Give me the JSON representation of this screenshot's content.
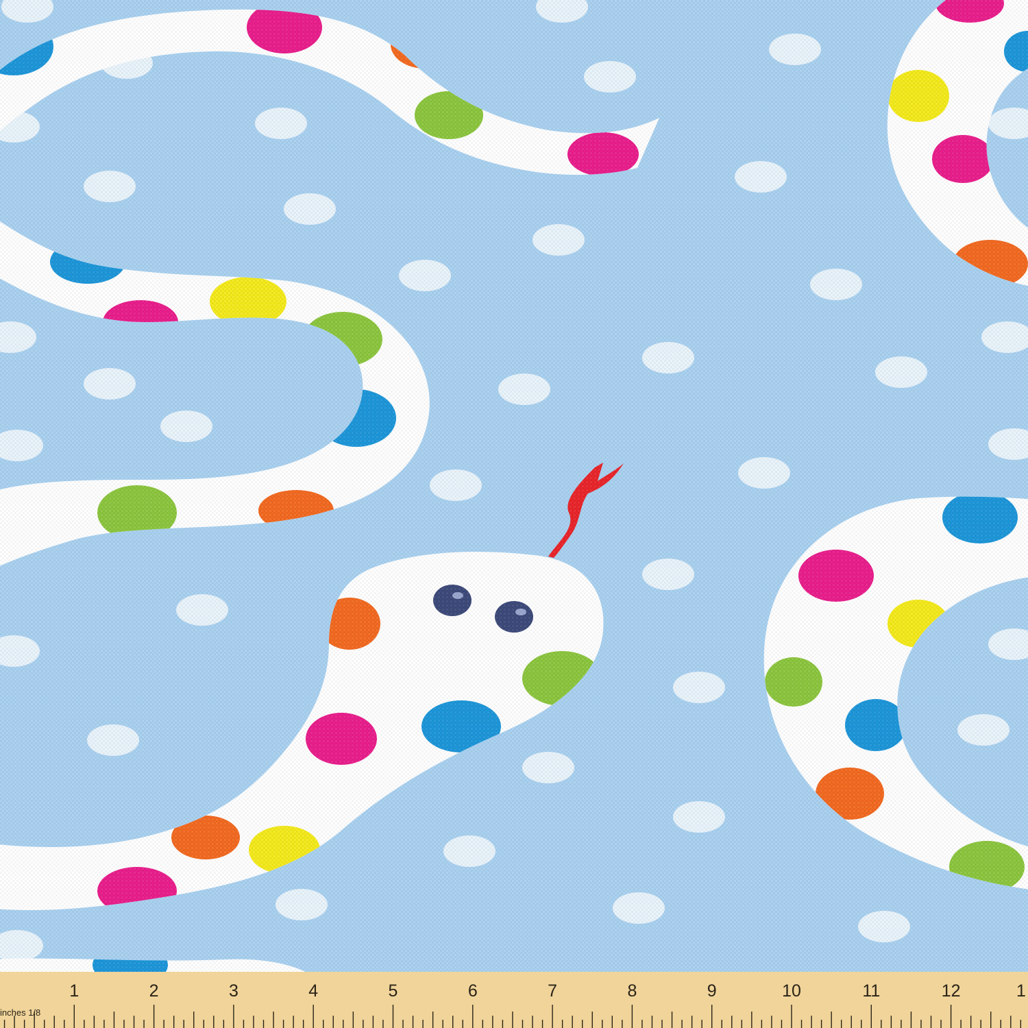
{
  "image": {
    "subject": "snake",
    "colors": {
      "background": "#a9d1f0",
      "background_dot": "#e9f3fb",
      "snake_body": "#ffffff",
      "pink": "#e91e8c",
      "orange": "#f26a21",
      "green": "#8cc63f",
      "blue": "#1d96d9",
      "yellow": "#f4ea1c",
      "tongue": "#e8262b",
      "eye": "#3d4a7a",
      "ruler_wood": "#f0d49a",
      "ruler_ink": "#2b2418"
    }
  },
  "ruler": {
    "unit_label": "inches 1/8",
    "numbers": [
      "1",
      "2",
      "3",
      "4",
      "5",
      "6",
      "7",
      "8",
      "9",
      "10",
      "11",
      "12",
      "1"
    ]
  }
}
